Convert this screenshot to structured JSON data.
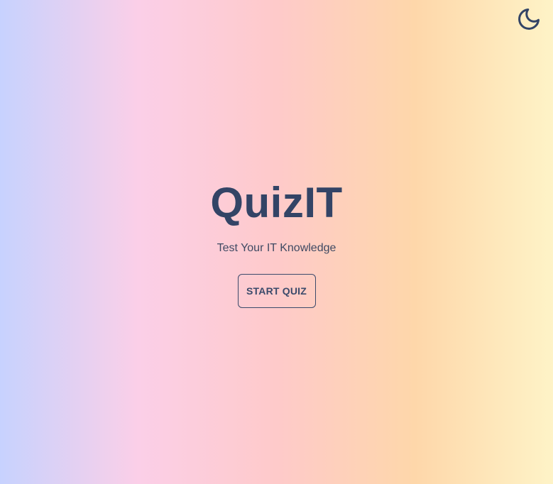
{
  "header": {
    "theme_toggle_icon": "moon-icon",
    "icon_color": "#334466"
  },
  "hero": {
    "title": "QuizIT",
    "subtitle": "Test Your IT Knowledge",
    "start_button_label": "START QUIZ"
  },
  "colors": {
    "text": "#334466",
    "gradient": [
      "#c7d2fe",
      "#fbcfe8",
      "#fecaca",
      "#fed7aa",
      "#fef3c7"
    ]
  }
}
